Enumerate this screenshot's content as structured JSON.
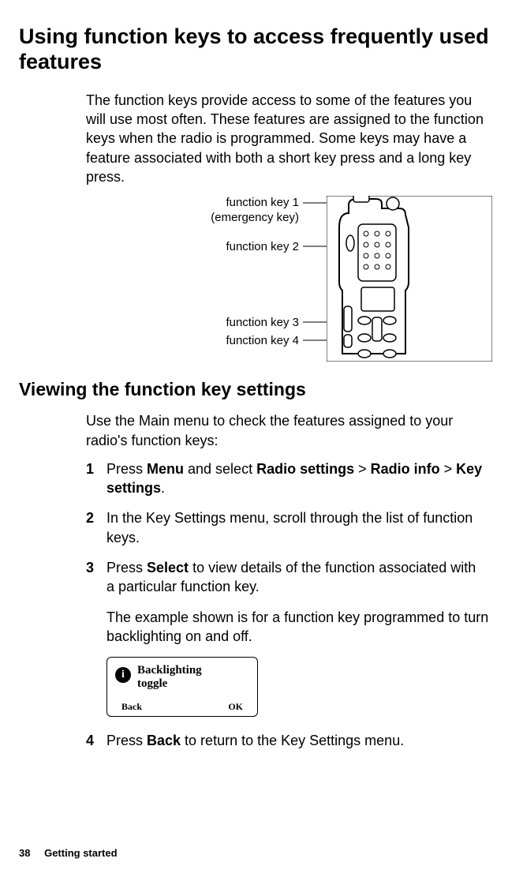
{
  "heading": "Using function keys to access frequently used features",
  "intro": "The function keys provide access to some of the features you will use most often. These features are assigned to the function keys when the radio is programmed. Some keys may have a feature associated with both a short key press and a long key press.",
  "diagram": {
    "label1_line1": "function key 1",
    "label1_line2": "(emergency key)",
    "label2": "function key 2",
    "label3": "function key 3",
    "label4": "function key 4"
  },
  "subheading": "Viewing the function key settings",
  "use_text": "Use the Main menu to check the features assigned to your radio's function keys:",
  "steps": {
    "s1_pre": "Press ",
    "s1_menu": "Menu",
    "s1_mid1": " and select ",
    "s1_rs": "Radio settings",
    "s1_gt1": " > ",
    "s1_ri": "Radio info",
    "s1_gt2": " > ",
    "s1_ks": "Key settings",
    "s1_end": ".",
    "s2": "In the Key Settings menu, scroll through the list of function keys.",
    "s3_pre": "Press ",
    "s3_select": "Select",
    "s3_post": " to view details of the function associated with a particular function key.",
    "s3_example": "The example shown is for a function key programmed to turn backlighting on and off.",
    "s4_pre": "Press ",
    "s4_back": "Back",
    "s4_post": " to return to the Key Settings menu."
  },
  "screen": {
    "info_icon": "i",
    "line1": "Backlighting",
    "line2": "toggle",
    "back": "Back",
    "ok": "OK"
  },
  "footer": {
    "page": "38",
    "section": "Getting started"
  }
}
